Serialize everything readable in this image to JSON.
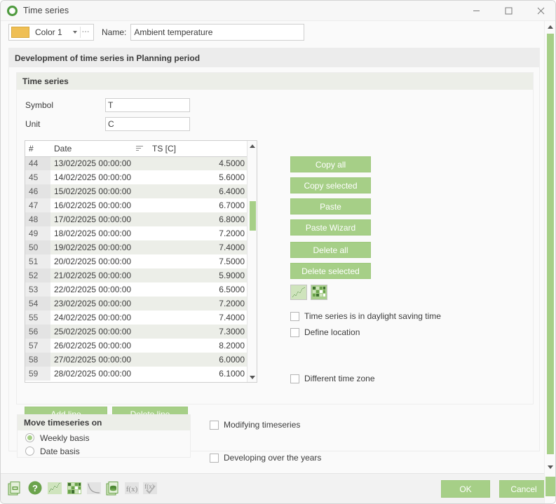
{
  "window": {
    "title": "Time series",
    "icon": "ring-icon",
    "controls": {
      "minimize": "—",
      "maximize": "☐",
      "close": "✕"
    }
  },
  "toprow": {
    "color_label": "Color 1",
    "color_hex": "#EFBF55",
    "name_label": "Name:",
    "name_value": "Ambient temperature"
  },
  "group_development": {
    "title": "Development of time series in Planning period"
  },
  "group_timeseries": {
    "title": "Time series",
    "symbol_label": "Symbol",
    "symbol_value": "T",
    "unit_label": "Unit",
    "unit_value": "C"
  },
  "table": {
    "columns": [
      "#",
      "Date",
      "TS [C]"
    ],
    "rows": [
      {
        "idx": "44",
        "date": "13/02/2025 00:00:00",
        "value": "4.5000"
      },
      {
        "idx": "45",
        "date": "14/02/2025 00:00:00",
        "value": "5.6000"
      },
      {
        "idx": "46",
        "date": "15/02/2025 00:00:00",
        "value": "6.4000"
      },
      {
        "idx": "47",
        "date": "16/02/2025 00:00:00",
        "value": "6.7000"
      },
      {
        "idx": "48",
        "date": "17/02/2025 00:00:00",
        "value": "6.8000"
      },
      {
        "idx": "49",
        "date": "18/02/2025 00:00:00",
        "value": "7.2000"
      },
      {
        "idx": "50",
        "date": "19/02/2025 00:00:00",
        "value": "7.4000"
      },
      {
        "idx": "51",
        "date": "20/02/2025 00:00:00",
        "value": "7.5000"
      },
      {
        "idx": "52",
        "date": "21/02/2025 00:00:00",
        "value": "5.9000"
      },
      {
        "idx": "53",
        "date": "22/02/2025 00:00:00",
        "value": "6.5000"
      },
      {
        "idx": "54",
        "date": "23/02/2025 00:00:00",
        "value": "7.2000"
      },
      {
        "idx": "55",
        "date": "24/02/2025 00:00:00",
        "value": "7.4000"
      },
      {
        "idx": "56",
        "date": "25/02/2025 00:00:00",
        "value": "7.3000"
      },
      {
        "idx": "57",
        "date": "26/02/2025 00:00:00",
        "value": "8.2000"
      },
      {
        "idx": "58",
        "date": "27/02/2025 00:00:00",
        "value": "6.0000"
      },
      {
        "idx": "59",
        "date": "28/02/2025 00:00:00",
        "value": "6.1000"
      }
    ]
  },
  "side_buttons": [
    "Copy all",
    "Copy selected",
    "Paste",
    "Paste Wizard",
    "Delete all",
    "Delete selected"
  ],
  "mini_icons": [
    "line-chart-icon",
    "heatmap-icon"
  ],
  "checkboxes": [
    {
      "label": "Time series is in daylight saving time",
      "checked": false
    },
    {
      "label": "Define location",
      "checked": false
    },
    {
      "label": "Different time zone",
      "checked": false
    }
  ],
  "line_buttons": [
    "Add line",
    "Delete line"
  ],
  "group_move": {
    "title": "Move timeseries on",
    "options": [
      {
        "label": "Weekly basis",
        "selected": true
      },
      {
        "label": "Date basis",
        "selected": false
      }
    ]
  },
  "right_checkboxes": [
    {
      "label": "Modifying timeseries",
      "checked": false
    },
    {
      "label": "Developing over the years",
      "checked": false
    }
  ],
  "bottom_toolbar": [
    "copy-document-icon",
    "help-icon",
    "line-chart-icon",
    "heatmap-icon",
    "curve-decay-icon",
    "database-document-icon",
    "function-icon",
    "function-check-icon"
  ],
  "dialog_buttons": {
    "ok": "OK",
    "cancel": "Cancel"
  },
  "accent": {
    "green": "#A6CF87",
    "header_gray": "#ECECEC",
    "section_gray": "#ECEEE8"
  }
}
